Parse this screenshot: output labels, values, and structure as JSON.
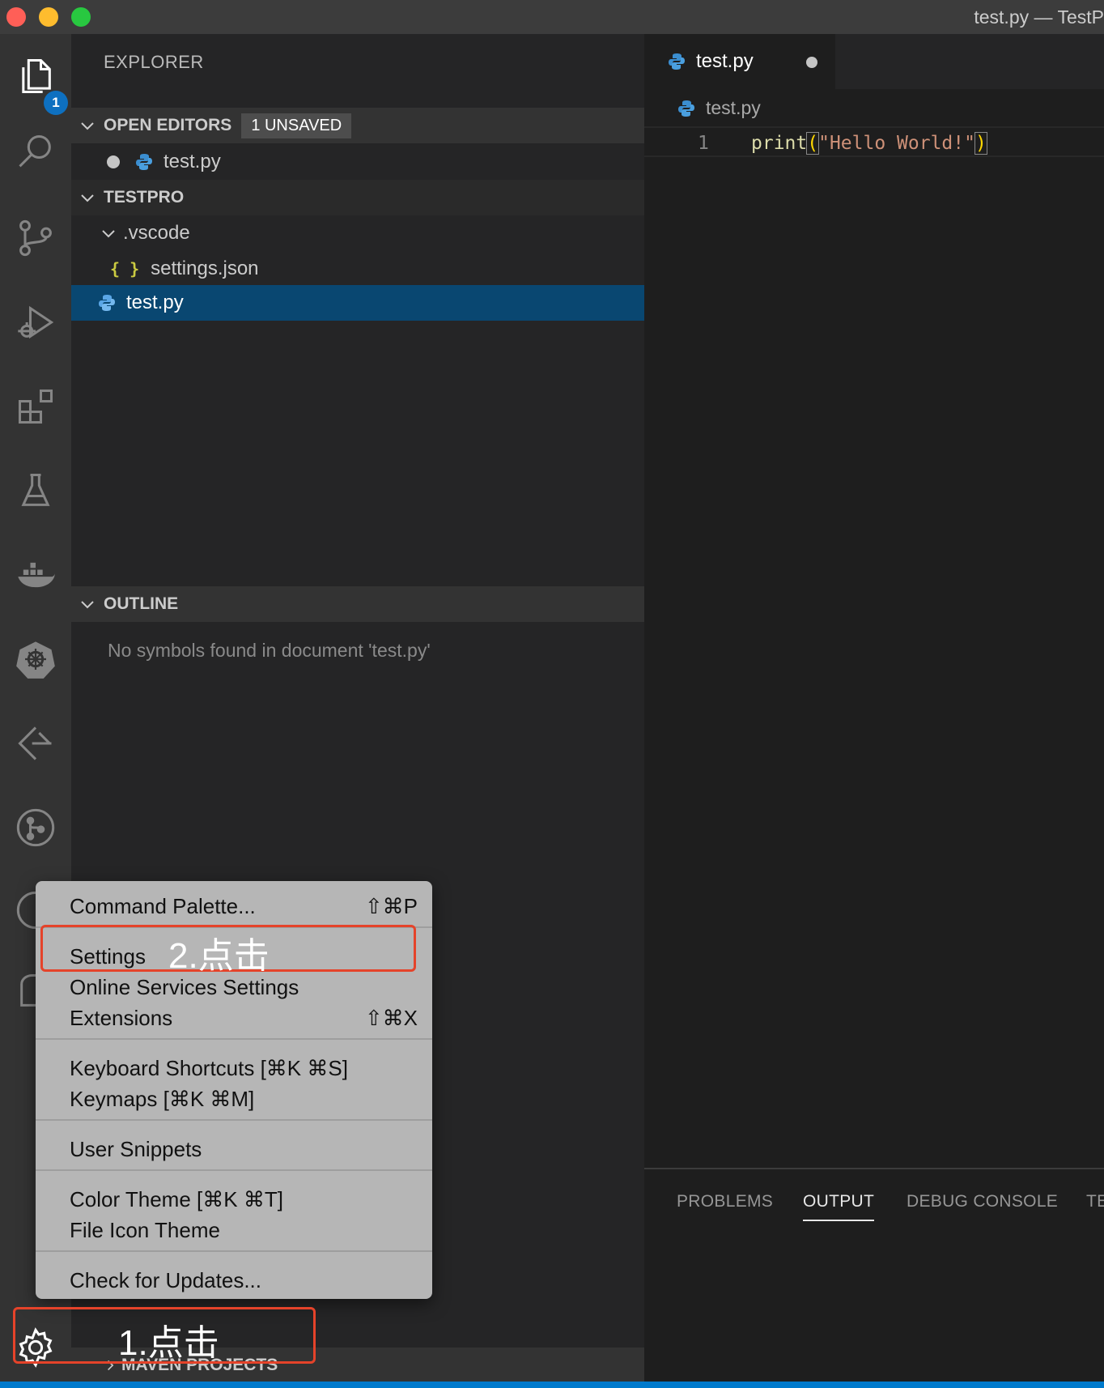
{
  "window": {
    "title": "test.py — TestP"
  },
  "activity_bar": {
    "explorer_badge": "1"
  },
  "sidebar": {
    "title": "EXPLORER",
    "open_editors": {
      "label": "OPEN EDITORS",
      "badge": "1 UNSAVED",
      "file": "test.py"
    },
    "project": {
      "label": "TESTPRO",
      "folder": ".vscode",
      "folder_file": "settings.json",
      "selected_file": "test.py"
    },
    "outline": {
      "label": "OUTLINE",
      "message": "No symbols found in document 'test.py'"
    },
    "maven": {
      "label": "MAVEN PROJECTS"
    }
  },
  "editor": {
    "tab_label": "test.py",
    "breadcrumb": "test.py",
    "line_number": "1",
    "code": {
      "fn": "print",
      "open": "(",
      "str": "\"Hello World!\"",
      "close": ")"
    }
  },
  "panel": {
    "tabs": [
      "PROBLEMS",
      "OUTPUT",
      "DEBUG CONSOLE",
      "TE"
    ]
  },
  "menu": {
    "command_palette": "Command Palette...",
    "command_palette_shortcut": "⇧⌘P",
    "settings": "Settings",
    "online_services": "Online Services Settings",
    "extensions": "Extensions",
    "extensions_shortcut": "⇧⌘X",
    "keyboard_shortcuts": "Keyboard Shortcuts [⌘K ⌘S]",
    "keymaps": "Keymaps [⌘K ⌘M]",
    "user_snippets": "User Snippets",
    "color_theme": "Color Theme [⌘K ⌘T]",
    "file_icon_theme": "File Icon Theme",
    "check_updates": "Check for Updates..."
  },
  "annotations": {
    "step1": "1.点击",
    "step2": "2.点击"
  },
  "colors": {
    "accent": "#007acc",
    "selection": "#094771",
    "annotation": "#e5432a"
  }
}
